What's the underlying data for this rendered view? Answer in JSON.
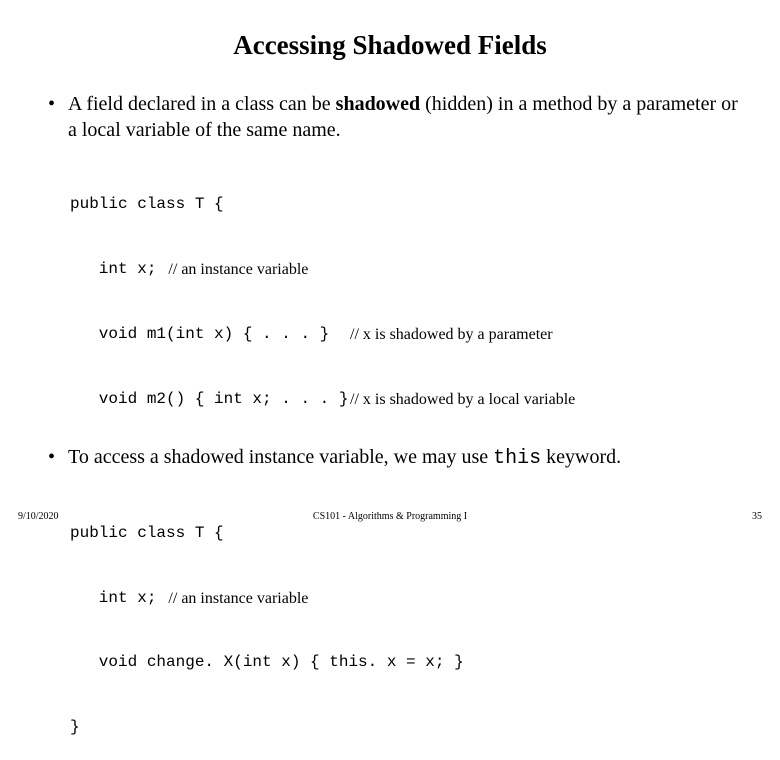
{
  "title": "Accessing Shadowed Fields",
  "bullet1": {
    "part1": "A field declared in a class can be ",
    "bold": "shadowed",
    "part2": " (hidden) in a method by a parameter or a local variable of the same name."
  },
  "code1": {
    "l1": "public class T {",
    "l2_code": "   int x;",
    "l2_comment": "   // an instance variable",
    "l3_code": "   void m1(int x) { . . . }",
    "l3_comment": "// x is shadowed by a parameter",
    "l4_code": "   void m2() { int x; . . . }",
    "l4_comment": "// x is shadowed by a local variable"
  },
  "bullet2": {
    "part1": "To access a shadowed instance variable, we may use ",
    "mono": "this",
    "part2": " keyword."
  },
  "code2": {
    "l1": "public class T {",
    "l2_code": "   int x;",
    "l2_comment": "   // an instance variable",
    "l3": "   void change. X(int x) { this. x = x; }",
    "l4": "}"
  },
  "footer": {
    "date": "9/10/2020",
    "center": "CS101 - Algorithms & Programming I",
    "page": "35"
  }
}
